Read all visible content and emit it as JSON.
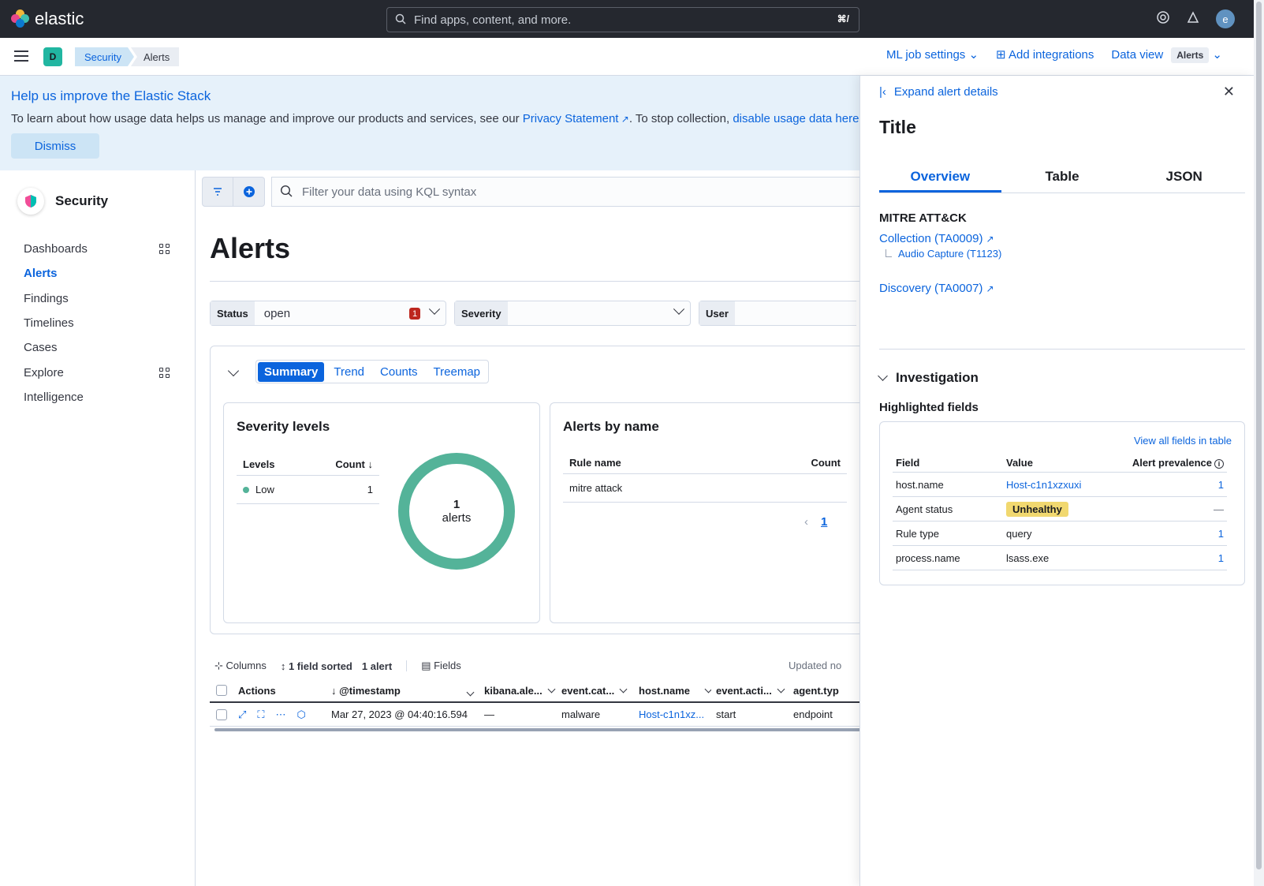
{
  "app": {
    "brand": "elastic",
    "avatar_letter": "e"
  },
  "search": {
    "placeholder": "Find apps, content, and more.",
    "shortcut": "⌘/"
  },
  "subbar": {
    "space": "D",
    "breadcrumbs": [
      "Security",
      "Alerts"
    ],
    "ml_job_settings": "ML job settings",
    "add_integrations": "Add integrations",
    "data_view_label": "Data view",
    "data_view_value": "Alerts"
  },
  "banner": {
    "title": "Help us improve the Elastic Stack",
    "text_before": "To learn about how usage data helps us manage and improve our products and services, see our ",
    "privacy_link": "Privacy Statement",
    "text_after": ". To stop collection, ",
    "disable_link": "disable usage data here",
    "dismiss": "Dismiss"
  },
  "sidebar": {
    "title": "Security",
    "items": [
      {
        "label": "Dashboards",
        "grid": true,
        "active": false
      },
      {
        "label": "Alerts",
        "grid": false,
        "active": true
      },
      {
        "label": "Findings",
        "grid": false,
        "active": false
      },
      {
        "label": "Timelines",
        "grid": false,
        "active": false
      },
      {
        "label": "Cases",
        "grid": false,
        "active": false
      },
      {
        "label": "Explore",
        "grid": true,
        "active": false
      },
      {
        "label": "Intelligence",
        "grid": false,
        "active": false
      }
    ]
  },
  "query": {
    "placeholder": "Filter your data using KQL syntax"
  },
  "main": {
    "title": "Alerts"
  },
  "filters": {
    "status_label": "Status",
    "status_value": "open",
    "status_count": "1",
    "severity_label": "Severity",
    "user_label": "User"
  },
  "summary_tabs": [
    "Summary",
    "Trend",
    "Counts",
    "Treemap"
  ],
  "severity": {
    "title": "Severity levels",
    "col_levels": "Levels",
    "col_count": "Count",
    "rows": [
      {
        "level": "Low",
        "count": "1"
      }
    ],
    "donut_value": "1",
    "donut_label": "alerts"
  },
  "alerts_by_name": {
    "title": "Alerts by name",
    "col_rule": "Rule name",
    "col_count": "Count",
    "rows": [
      {
        "rule": "mitre attack"
      }
    ],
    "page": "1"
  },
  "toolbar": {
    "columns": "Columns",
    "sorted": "1 field sorted",
    "count": "1 alert",
    "fields": "Fields",
    "updated": "Updated no"
  },
  "grid": {
    "headers": [
      "Actions",
      "@timestamp",
      "kibana.ale...",
      "event.cat...",
      "host.name",
      "event.acti...",
      "agent.typ"
    ],
    "row": {
      "timestamp": "Mar 27, 2023 @ 04:40:16.594",
      "kibana": "—",
      "category": "malware",
      "host": "Host-c1n1xz...",
      "action": "start",
      "agent": "endpoint"
    }
  },
  "flyout": {
    "expand": "Expand alert details",
    "title": "Title",
    "tabs": [
      "Overview",
      "Table",
      "JSON"
    ],
    "mitre_heading": "MITRE ATT&CK",
    "tactic1": "Collection (TA0009)",
    "technique1": "Audio Capture (T1123)",
    "tactic2": "Discovery (TA0007)",
    "investigation": "Investigation",
    "highlighted": "Highlighted fields",
    "view_all": "View all fields in table",
    "cols": {
      "field": "Field",
      "value": "Value",
      "prevalence": "Alert prevalence"
    },
    "fields": [
      {
        "field": "host.name",
        "value": "Host-c1n1xzxuxi",
        "prev": "1"
      },
      {
        "field": "Agent status",
        "value": "Unhealthy",
        "prev": "—"
      },
      {
        "field": "Rule type",
        "value": "query",
        "prev": "1"
      },
      {
        "field": "process.name",
        "value": "lsass.exe",
        "prev": "1"
      }
    ]
  },
  "colors": {
    "accent": "#0b64dd",
    "low_severity": "#54b399",
    "header_bg": "#25282f",
    "warning": "#f1d86f"
  }
}
